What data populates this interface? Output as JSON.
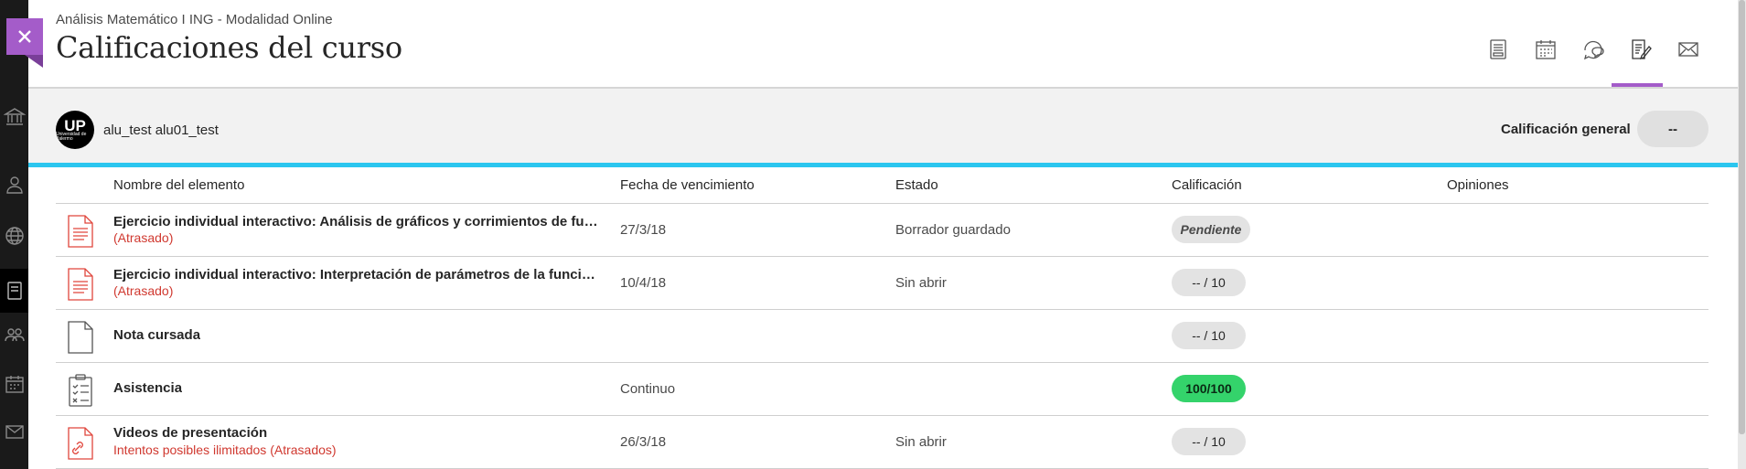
{
  "header": {
    "course_name": "Análisis Matemático I ING - Modalidad Online",
    "page_title": "Calificaciones del curso",
    "accent_color": "#a45cc9",
    "top_icons": [
      "book-icon",
      "calendar-icon",
      "discussion-icon",
      "grades-icon",
      "mail-icon"
    ],
    "active_tab": "grades-icon"
  },
  "left_rail": {
    "icons": [
      "institution-icon",
      "profile-icon",
      "globe-icon",
      "courses-icon",
      "groups-icon",
      "calendar-icon",
      "mail-icon"
    ]
  },
  "user": {
    "avatar_main": "UP",
    "avatar_sub": "Universidad de Palermo",
    "name": "alu_test alu01_test",
    "overall_label": "Calificación general",
    "overall_value": "--"
  },
  "table": {
    "columns": [
      "Nombre del elemento",
      "Fecha de vencimiento",
      "Estado",
      "Calificación",
      "Opiniones"
    ],
    "rows": [
      {
        "icon": "document-icon-red",
        "title": "Ejercicio individual interactivo: Análisis de gráficos y corrimientos de funcio...",
        "subtitle": "(Atrasado)",
        "due": "27/3/18",
        "status": "Borrador guardado",
        "grade": "Pendiente",
        "grade_style": "pending"
      },
      {
        "icon": "document-icon-red",
        "title": "Ejercicio individual interactivo: Interpretación de parámetros de la función li...",
        "subtitle": "(Atrasado)",
        "due": "10/4/18",
        "status": "Sin abrir",
        "grade": "-- / 10",
        "grade_style": "default"
      },
      {
        "icon": "blank-document-icon",
        "title": "Nota cursada",
        "subtitle": "",
        "due": "",
        "status": "",
        "grade": "-- / 10",
        "grade_style": "default"
      },
      {
        "icon": "attendance-icon",
        "title": "Asistencia",
        "subtitle": "",
        "due": "Continuo",
        "status": "",
        "grade": "100/100",
        "grade_style": "green"
      },
      {
        "icon": "link-document-icon-red",
        "title": "Videos de presentación",
        "subtitle": "Intentos posibles ilimitados (Atrasados)",
        "due": "26/3/18",
        "status": "Sin abrir",
        "grade": "-- / 10",
        "grade_style": "default"
      }
    ]
  }
}
